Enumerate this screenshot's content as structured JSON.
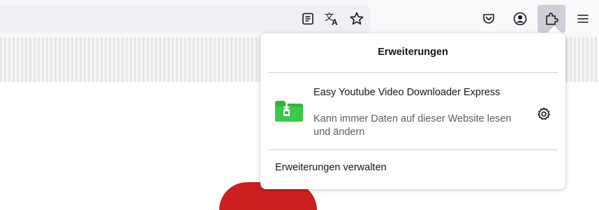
{
  "toolbar": {
    "icons": {
      "reader_view": "reader-view-icon",
      "translate": "translate-icon",
      "bookmark": "star-icon",
      "pocket": "pocket-icon",
      "account": "account-icon",
      "extensions": "puzzle-icon",
      "menu": "hamburger-menu-icon"
    },
    "extensions_button_active": true
  },
  "panel": {
    "title": "Erweiterungen",
    "extensions": [
      {
        "name": "Easy Youtube Video Downloader Express",
        "description": "Kann immer Daten auf dieser Website lesen und ändern",
        "icon": "green-folder-download-icon",
        "settings_icon": "gear-icon"
      }
    ],
    "manage_label": "Erweiterungen verwalten"
  },
  "colors": {
    "toolbar_bg": "#f9f9fb",
    "urlbar_bg": "#f0f0f4",
    "active_button_bg": "#cfcfd8",
    "text_primary": "#15141a",
    "text_secondary": "#5b5b66",
    "extension_green": "#2fb83a",
    "page_accent_red": "#cc1f1f"
  }
}
